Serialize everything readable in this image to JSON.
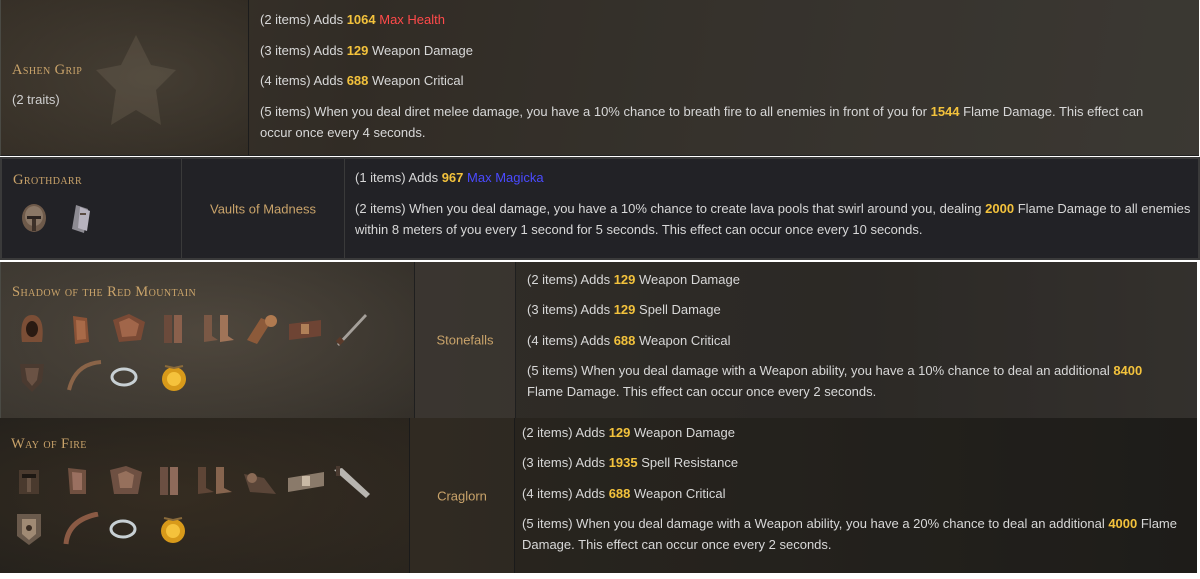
{
  "sets": [
    {
      "name": "Ashen Grip",
      "traits": "(2 traits)",
      "bonuses": [
        {
          "pre": "(2 items) Adds ",
          "value": "1064",
          "post": " ",
          "stat": "Max Health"
        },
        {
          "pre": "(3 items) Adds ",
          "value": "129",
          "post": " Weapon Damage"
        },
        {
          "pre": "(4 items) Adds ",
          "value": "688",
          "post": " Weapon Critical"
        },
        {
          "pre": "(5 items) When you deal diret melee damage, you have a 10% chance to breath fire to all enemies in front of you for ",
          "value": "1544",
          "post": " Flame Damage. This effect can occur once every 4 seconds."
        }
      ]
    },
    {
      "name": "Grothdarr",
      "location": "Vaults of Madness",
      "bonuses": [
        {
          "pre": "(1 items) Adds ",
          "value": "967",
          "post": " ",
          "stat": "Max Magicka"
        },
        {
          "pre": "(2 items) When you deal damage, you have a 10% chance to create lava pools that swirl around you, dealing ",
          "value": "2000",
          "post": " Flame Damage to all enemies within 8 meters of you every 1 second for 5 seconds. This effect can occur once every 10 seconds."
        }
      ],
      "icons": [
        "helmet-icon",
        "shoulder-icon"
      ]
    },
    {
      "name": "Shadow of the Red Mountain",
      "location": "Stonefalls",
      "bonuses": [
        {
          "pre": "(2 items) Adds ",
          "value": "129",
          "post": " Weapon Damage"
        },
        {
          "pre": "(3 items) Adds ",
          "value": "129",
          "post": " Spell Damage"
        },
        {
          "pre": "(4 items) Adds ",
          "value": "688",
          "post": " Weapon Critical"
        },
        {
          "pre": "(5 items) When you deal damage with a Weapon ability, you have a 10% chance to deal an additional ",
          "value": "8400",
          "post": " Flame Damage. This effect can occur once every 2 seconds."
        }
      ],
      "icons": [
        "hood-icon",
        "shoulder-icon",
        "chest-icon",
        "legs-icon",
        "boots-icon",
        "gloves-icon",
        "belt-icon",
        "dagger-icon",
        "shield-icon",
        "bow-icon",
        "ring-icon",
        "amulet-icon"
      ]
    },
    {
      "name": "Way of Fire",
      "location": "Craglorn",
      "bonuses": [
        {
          "pre": "(2 items) Adds ",
          "value": "129",
          "post": " Weapon Damage"
        },
        {
          "pre": "(3 items) Adds ",
          "value": "1935",
          "post": " Spell Resistance"
        },
        {
          "pre": "(4 items) Adds ",
          "value": "688",
          "post": " Weapon Critical"
        },
        {
          "pre": "(5 items) When you deal damage with a Weapon ability, you have a 20% chance to deal an additional ",
          "value": "4000",
          "post": " Flame Damage. This effect can occur once every 2 seconds."
        }
      ],
      "icons": [
        "helmet-icon",
        "shoulder-icon",
        "chest-icon",
        "legs-icon",
        "boots-icon",
        "gloves-icon",
        "belt-icon",
        "sword-icon",
        "shield-icon",
        "bow-icon",
        "ring-icon",
        "amulet-icon"
      ]
    }
  ]
}
